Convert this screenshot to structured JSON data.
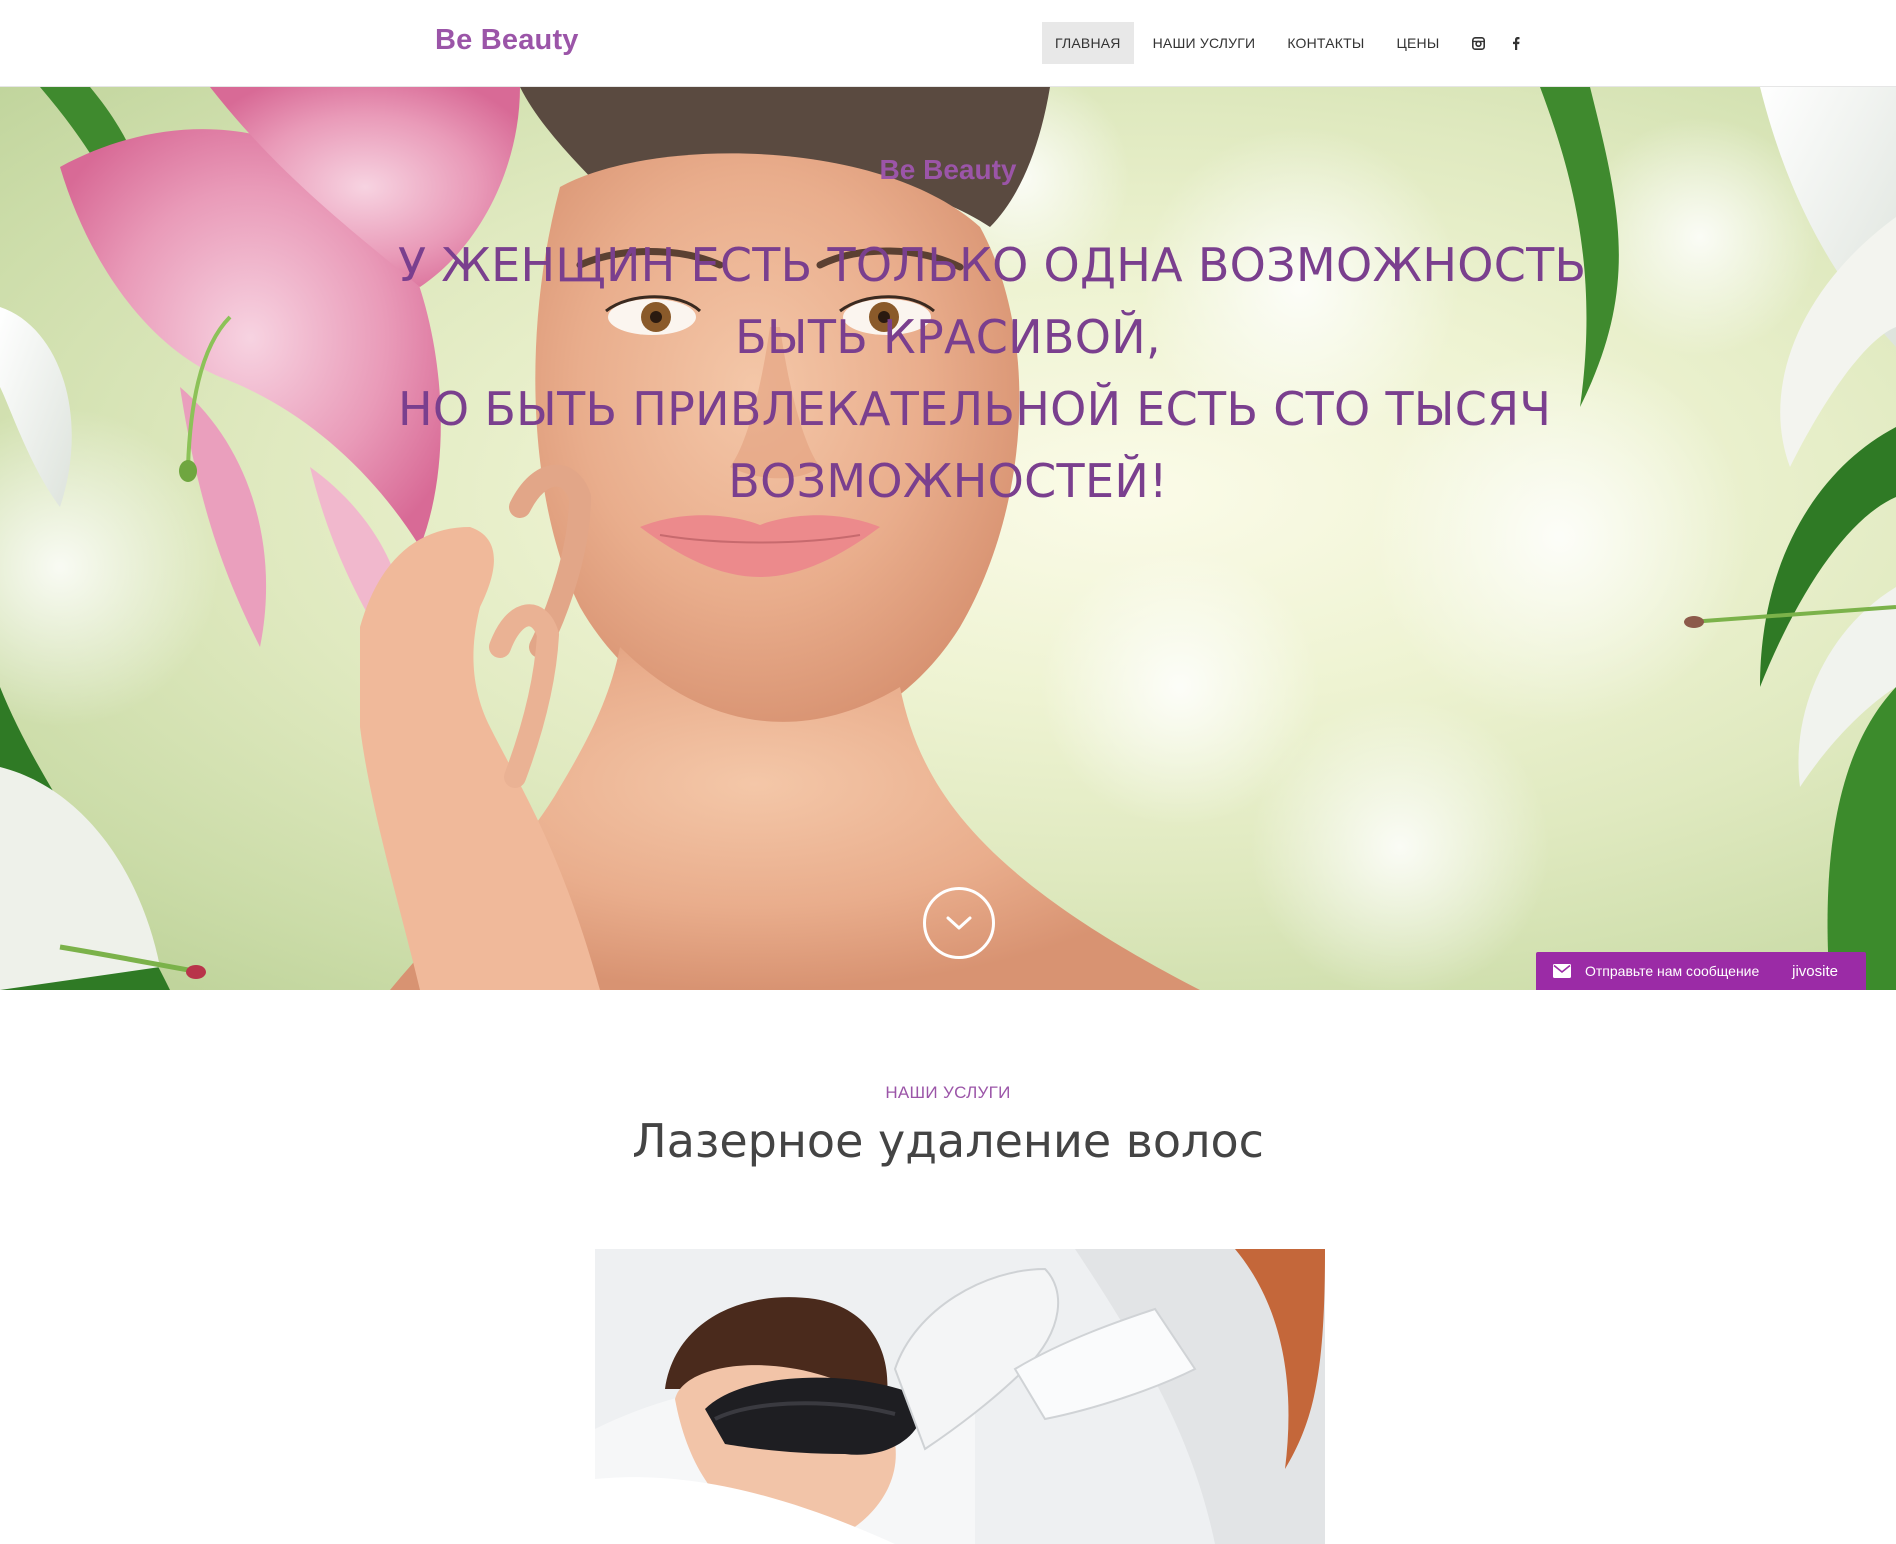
{
  "header": {
    "logo": "Be Beauty",
    "nav": [
      {
        "label": "ГЛАВНАЯ",
        "active": true
      },
      {
        "label": "НАШИ УСЛУГИ",
        "active": false
      },
      {
        "label": "КОНТАКТЫ",
        "active": false
      },
      {
        "label": "ЦЕНЫ",
        "active": false
      }
    ],
    "social": [
      "instagram-icon",
      "facebook-icon"
    ]
  },
  "hero": {
    "brand": "Be Beauty",
    "quote_lines": [
      "У ЖЕНЩИН ЕСТЬ ТОЛЬКО ОДНА ВОЗМОЖНОСТЬ",
      "БЫТЬ КРАСИВОЙ,",
      "НО БЫТЬ ПРИВЛЕКАТЕЛЬНОЙ ЕСТЬ СТО ТЫСЯЧ",
      "ВОЗМОЖНОСТЕЙ!"
    ],
    "scroll_icon": "chevron-down-icon"
  },
  "chat": {
    "label": "Отправьте нам сообщение",
    "brand": "jivosite",
    "color": "#9b2ba6"
  },
  "services": {
    "kicker": "НАШИ УСЛУГИ",
    "title": "Лазерное удаление волос"
  },
  "colors": {
    "accent": "#9b55a8",
    "quote": "#7a3f8e"
  }
}
